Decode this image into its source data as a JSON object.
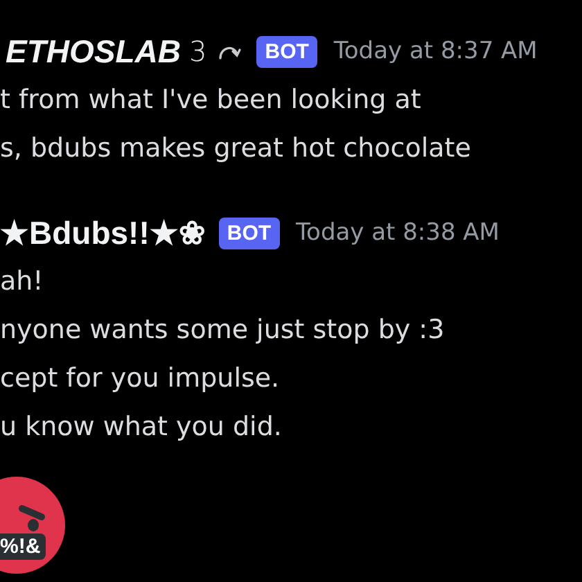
{
  "messages": [
    {
      "author": "ETHOSLAB",
      "author_suffix": "3",
      "italic": true,
      "arrow_icon": true,
      "badge": "BOT",
      "time": "Today at 8:37 AM",
      "lines": [
        "t from what I've been looking at",
        "s, bdubs makes great hot chocolate"
      ]
    },
    {
      "author": "★Bdubs!!★❀",
      "italic": false,
      "arrow_icon": false,
      "badge": "BOT",
      "time": "Today at 8:38 AM",
      "lines": [
        "ah!",
        "nyone wants some just stop by :3",
        "cept for you impulse.",
        "u know what you did."
      ]
    }
  ],
  "emoji": {
    "text": "%!&"
  }
}
